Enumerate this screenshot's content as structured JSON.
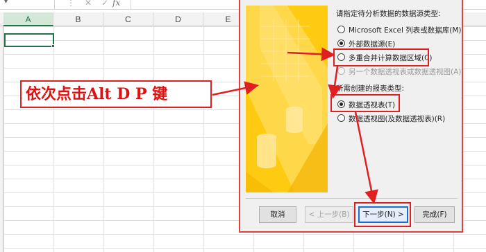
{
  "excel": {
    "fx_label": "fx",
    "columns": [
      "A",
      "B",
      "C",
      "D",
      "E"
    ]
  },
  "dialog": {
    "source_heading": "请指定待分析数据的数据源类型:",
    "source_options": [
      {
        "label": "Microsoft Excel 列表或数据库(M)",
        "checked": false,
        "disabled": false
      },
      {
        "label": "外部数据源(E)",
        "checked": true,
        "disabled": false
      },
      {
        "label": "多重合并计算数据区域(C)",
        "checked": false,
        "disabled": false
      },
      {
        "label": "另一个数据透视表或数据透视图(A)",
        "checked": false,
        "disabled": true
      }
    ],
    "report_heading": "所需创建的报表类型:",
    "report_options": [
      {
        "label": "数据透视表(T)",
        "checked": true,
        "disabled": false
      },
      {
        "label": "数据透视图(及数据透视表)(R)",
        "checked": false,
        "disabled": false
      }
    ],
    "buttons": {
      "cancel": "取消",
      "back": "< 上一步(B)",
      "next": "下一步(N) >",
      "finish": "完成(F)"
    }
  },
  "annotation": {
    "callout_text": "依次点击Alt D P 键",
    "color": "#e02020"
  },
  "colors": {
    "excel_green": "#217346",
    "wizard_art": "#ffca12",
    "default_button_border": "#1a6fd6"
  }
}
